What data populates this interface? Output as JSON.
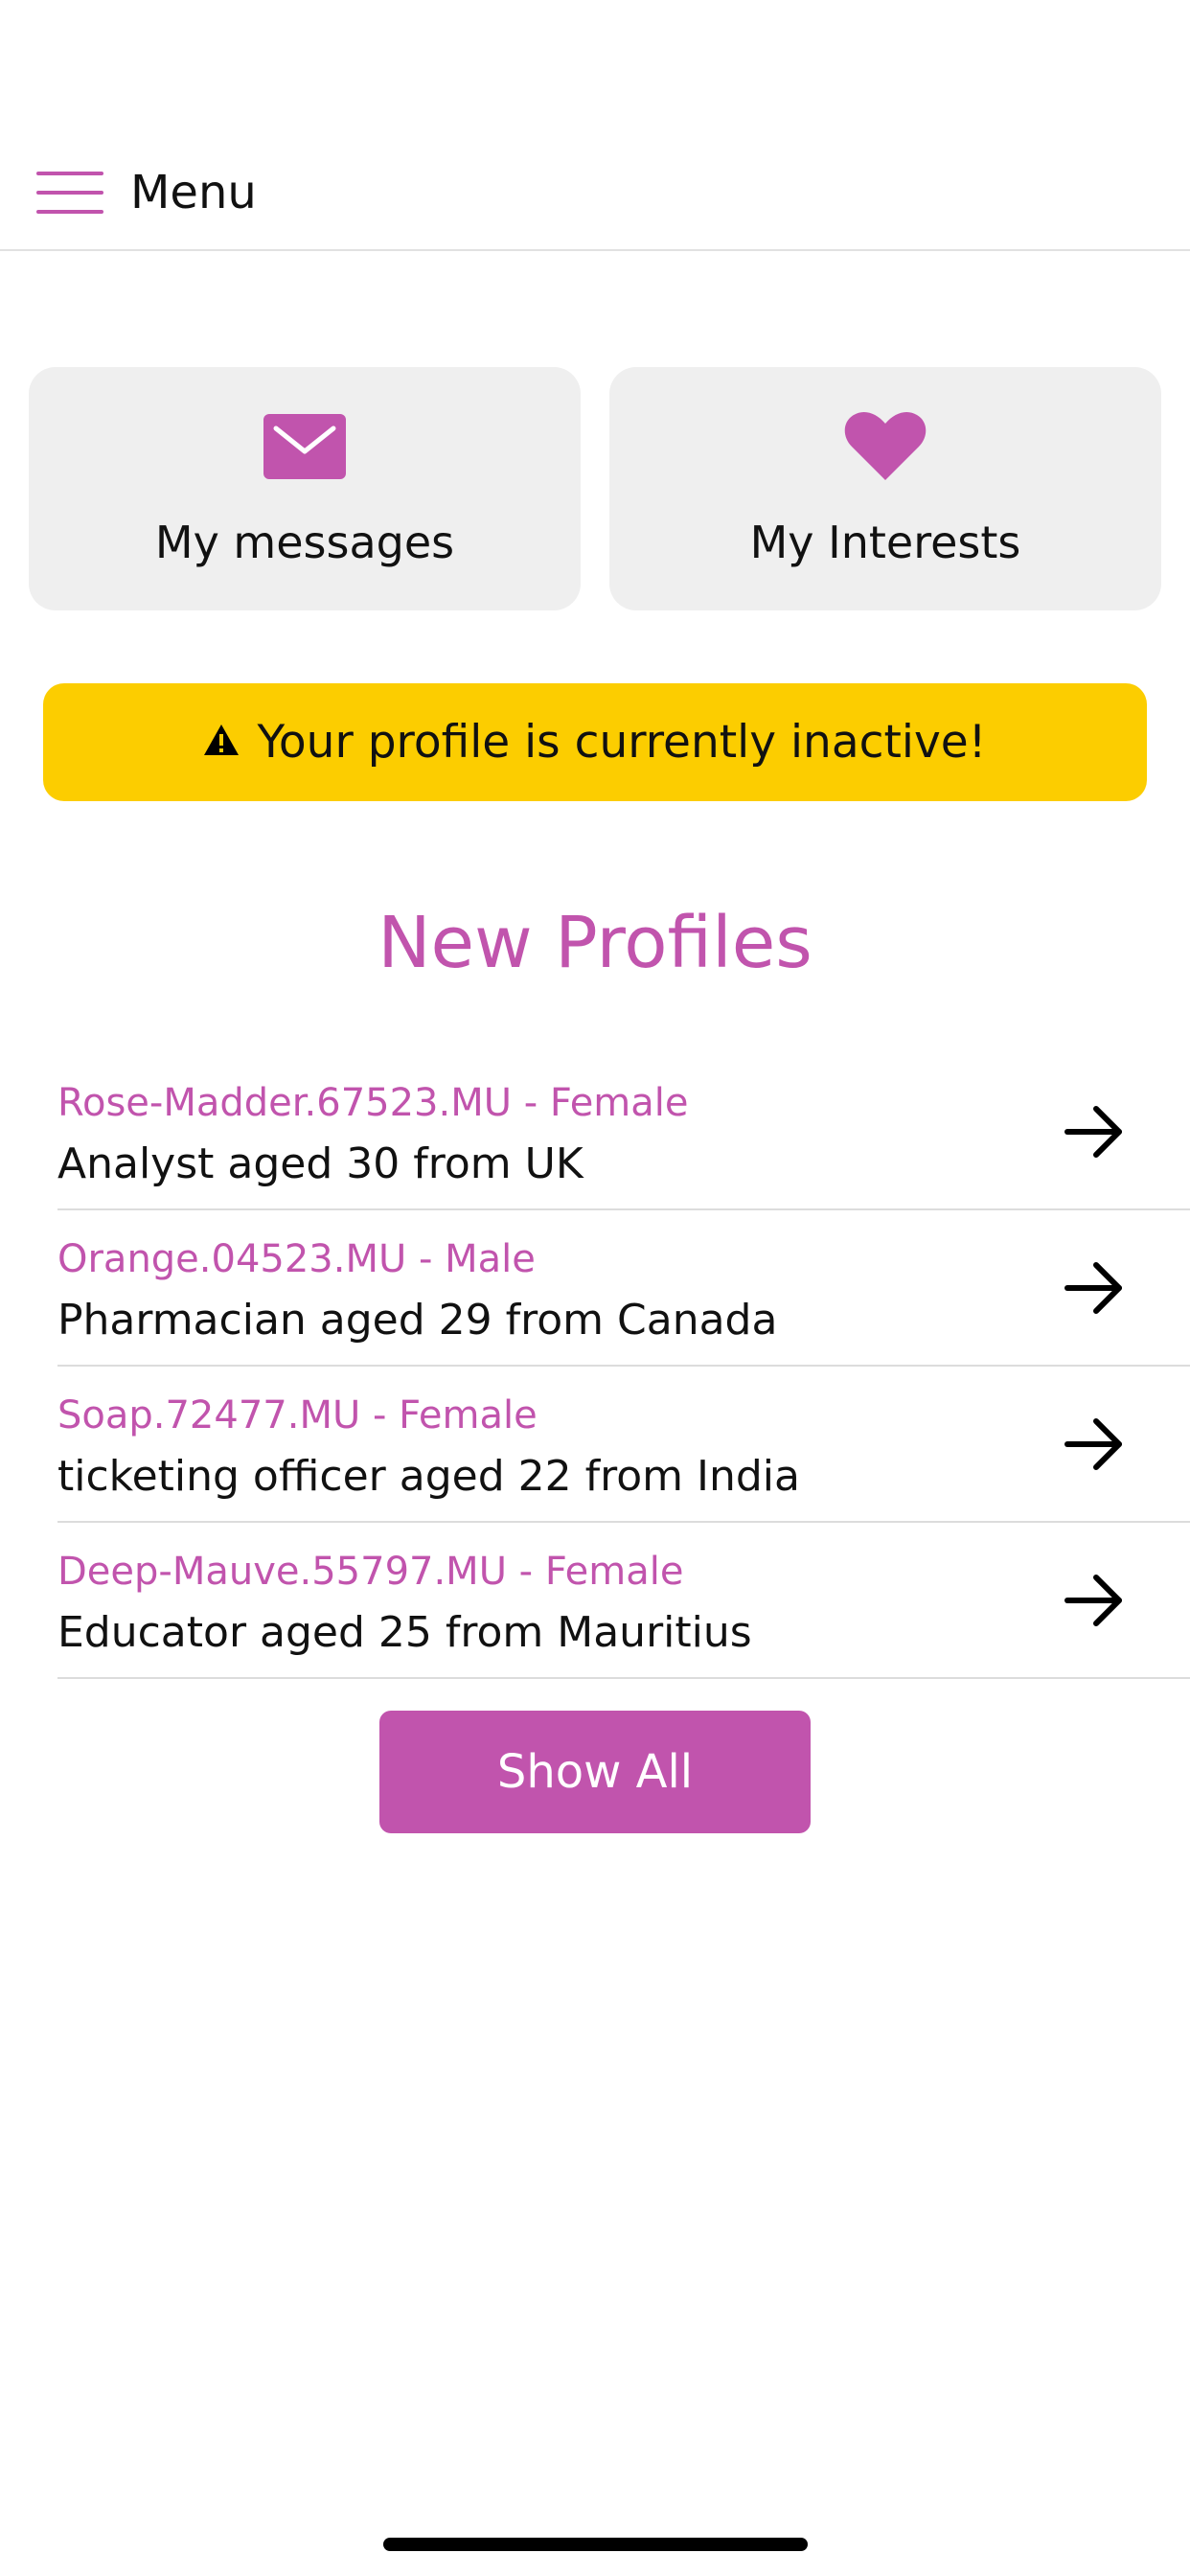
{
  "header": {
    "menu_label": "Menu",
    "menu_icon": "hamburger-icon"
  },
  "quick_actions": [
    {
      "label": "My messages",
      "icon": "envelope-icon"
    },
    {
      "label": "My Interests",
      "icon": "heart-icon"
    }
  ],
  "alert": {
    "text": "Your profile is currently inactive!",
    "icon": "warning-icon",
    "color": "#fccd00"
  },
  "new_profiles": {
    "title": "New Profiles",
    "items": [
      {
        "name": "Rose-Madder.67523.MU - Female",
        "description": "Analyst aged 30 from UK"
      },
      {
        "name": "Orange.04523.MU - Male",
        "description": "Pharmacian aged 29 from Canada"
      },
      {
        "name": "Soap.72477.MU - Female",
        "description": "ticketing officer aged 22 from India"
      },
      {
        "name": "Deep-Mauve.55797.MU - Female",
        "description": "Educator aged 25 from Mauritius"
      }
    ],
    "show_all_label": "Show All"
  },
  "colors": {
    "accent": "#c154ad",
    "card_background": "#efefef",
    "alert_background": "#fccd00"
  }
}
